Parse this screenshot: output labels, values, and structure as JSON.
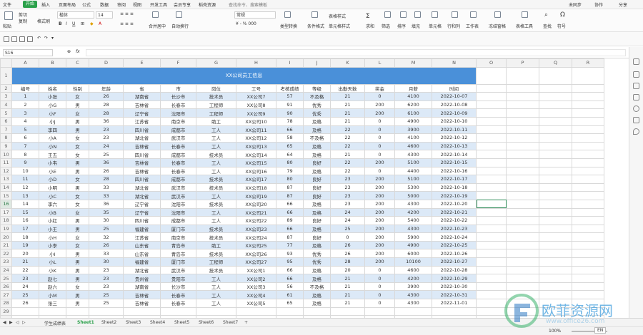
{
  "menubar": {
    "items": [
      "文件",
      "开始",
      "插入",
      "页面布局",
      "公式",
      "数据",
      "审阅",
      "视图",
      "开发工具",
      "会员专享",
      "稻壳资源"
    ],
    "search": "查找命令、搜索模板",
    "right": [
      "未同步",
      "协作",
      "分享"
    ]
  },
  "ribbon": {
    "left": [
      "粘贴",
      "剪切",
      "复制",
      "格式刷"
    ],
    "font_name": "楷体",
    "font_size": "14",
    "merge": "合并居中",
    "wrap": "自动换行",
    "number_format": "常规",
    "labels": [
      "类型转换",
      "条件格式",
      "表格样式",
      "单元格样式",
      "求和",
      "筛选",
      "排序",
      "填充",
      "单元格",
      "行和列",
      "工作表",
      "冻结窗格",
      "表格工具",
      "查找",
      "符号"
    ]
  },
  "formula_bar": {
    "cell_ref": "S16",
    "fx": "fx",
    "content": ""
  },
  "columns": [
    "A",
    "B",
    "C",
    "D",
    "E",
    "F",
    "G",
    "H",
    "I",
    "J",
    "K",
    "L",
    "M",
    "N",
    "O",
    "P",
    "Q",
    "R",
    "S",
    "T",
    "U",
    "V"
  ],
  "selected_col": "S",
  "selected_row": "16",
  "title": "XX公司员工信息",
  "headers": [
    "编号",
    "姓名",
    "性别",
    "年龄",
    "省",
    "市",
    "岗位",
    "工号",
    "考核成绩",
    "等级",
    "出勤天数",
    "奖金",
    "月薪",
    "时间"
  ],
  "rows": [
    [
      "1",
      "小张",
      "女",
      "26",
      "湖南省",
      "长沙市",
      "技术员",
      "XX公司7",
      "57",
      "不及格",
      "21",
      "0",
      "4100",
      "2022-10-07"
    ],
    [
      "2",
      "小G",
      "男",
      "28",
      "吉林省",
      "长春市",
      "工程师",
      "XX公司8",
      "91",
      "优秀",
      "21",
      "200",
      "6200",
      "2022-10-08"
    ],
    [
      "3",
      "小F",
      "女",
      "28",
      "辽宁省",
      "沈阳市",
      "工程师",
      "XX公司9",
      "90",
      "优秀",
      "21",
      "200",
      "6100",
      "2022-10-09"
    ],
    [
      "4",
      "小J",
      "男",
      "36",
      "江苏省",
      "南京市",
      "助工",
      "XX公司10",
      "78",
      "及格",
      "21",
      "0",
      "4900",
      "2022-10-10"
    ],
    [
      "5",
      "李四",
      "男",
      "23",
      "四川省",
      "成都市",
      "工人",
      "XX公司11",
      "66",
      "及格",
      "22",
      "0",
      "3900",
      "2022-10-11"
    ],
    [
      "6",
      "小A",
      "女",
      "23",
      "湖北省",
      "武汉市",
      "工人",
      "XX公司12",
      "58",
      "不及格",
      "22",
      "0",
      "4100",
      "2022-10-12"
    ],
    [
      "7",
      "小N",
      "女",
      "24",
      "吉林省",
      "长春市",
      "工人",
      "XX公司13",
      "65",
      "及格",
      "22",
      "0",
      "4600",
      "2022-10-13"
    ],
    [
      "8",
      "王五",
      "女",
      "25",
      "四川省",
      "成都市",
      "技术员",
      "XX公司14",
      "64",
      "及格",
      "21",
      "0",
      "4300",
      "2022-10-14"
    ],
    [
      "9",
      "小韦",
      "男",
      "36",
      "吉林省",
      "长春市",
      "工人",
      "XX公司15",
      "80",
      "良好",
      "22",
      "200",
      "5100",
      "2022-10-15"
    ],
    [
      "10",
      "小E",
      "男",
      "26",
      "吉林省",
      "长春市",
      "工人",
      "XX公司16",
      "79",
      "及格",
      "22",
      "0",
      "4400",
      "2022-10-16"
    ],
    [
      "11",
      "小D",
      "女",
      "28",
      "四川省",
      "成都市",
      "技术员",
      "XX公司17",
      "80",
      "良好",
      "23",
      "200",
      "5100",
      "2022-10-17"
    ],
    [
      "12",
      "小明",
      "男",
      "33",
      "湖北省",
      "武汉市",
      "技术员",
      "XX公司18",
      "87",
      "良好",
      "23",
      "200",
      "5300",
      "2022-10-18"
    ],
    [
      "13",
      "小C",
      "女",
      "33",
      "湖北省",
      "武汉市",
      "工人",
      "XX公司19",
      "87",
      "良好",
      "23",
      "200",
      "5000",
      "2022-10-19"
    ],
    [
      "14",
      "李六",
      "女",
      "36",
      "辽宁省",
      "沈阳市",
      "技术员",
      "XX公司20",
      "66",
      "及格",
      "23",
      "200",
      "4300",
      "2022-10-20"
    ],
    [
      "15",
      "小B",
      "女",
      "35",
      "辽宁省",
      "沈阳市",
      "工人",
      "XX公司21",
      "66",
      "及格",
      "24",
      "200",
      "4200",
      "2022-10-21"
    ],
    [
      "16",
      "小红",
      "男",
      "30",
      "四川省",
      "成都市",
      "工人",
      "XX公司22",
      "89",
      "良好",
      "24",
      "200",
      "5400",
      "2022-10-22"
    ],
    [
      "17",
      "小王",
      "男",
      "25",
      "福建省",
      "厦门市",
      "技术员",
      "XX公司23",
      "66",
      "及格",
      "25",
      "200",
      "4300",
      "2022-10-23"
    ],
    [
      "18",
      "小H",
      "女",
      "32",
      "江苏省",
      "南京市",
      "技术员",
      "XX公司24",
      "87",
      "良好",
      "0",
      "200",
      "5900",
      "2022-10-24"
    ],
    [
      "19",
      "小李",
      "女",
      "26",
      "山东省",
      "青岛市",
      "助工",
      "XX公司25",
      "77",
      "及格",
      "26",
      "200",
      "4900",
      "2022-10-25"
    ],
    [
      "20",
      "小I",
      "男",
      "33",
      "山东省",
      "青岛市",
      "技术员",
      "XX公司26",
      "93",
      "优秀",
      "26",
      "200",
      "6000",
      "2022-10-26"
    ],
    [
      "21",
      "小L",
      "男",
      "30",
      "福建省",
      "厦门市",
      "工程师",
      "XX公司27",
      "95",
      "优秀",
      "28",
      "200",
      "10100",
      "2022-10-27"
    ],
    [
      "22",
      "小K",
      "男",
      "23",
      "湖北省",
      "武汉市",
      "技术员",
      "XX公司1",
      "66",
      "及格",
      "20",
      "0",
      "4600",
      "2022-10-28"
    ],
    [
      "23",
      "赵七",
      "男",
      "23",
      "贵州省",
      "贵阳市",
      "工人",
      "XX公司2",
      "66",
      "及格",
      "21",
      "0",
      "4200",
      "2022-10-29"
    ],
    [
      "24",
      "赵六",
      "女",
      "23",
      "湖南省",
      "长沙市",
      "工人",
      "XX公司3",
      "56",
      "不及格",
      "21",
      "0",
      "3900",
      "2022-10-30"
    ],
    [
      "25",
      "小M",
      "男",
      "25",
      "吉林省",
      "长春市",
      "工人",
      "XX公司4",
      "61",
      "及格",
      "21",
      "0",
      "4300",
      "2022-10-31"
    ],
    [
      "26",
      "张三",
      "男",
      "25",
      "吉林省",
      "长春市",
      "工人",
      "XX公司5",
      "65",
      "及格",
      "21",
      "0",
      "4300",
      "2022-11-01"
    ]
  ],
  "empty_row_numbers": [
    "29",
    "30"
  ],
  "sheet_tabs": [
    "学生成绩表",
    "Sheet1",
    "Sheet2",
    "Sheet3",
    "Sheet4",
    "Sheet5",
    "Sheet6",
    "Sheet7"
  ],
  "active_tab": "Sheet1",
  "status": {
    "zoom": "100%",
    "lang": "EN"
  },
  "watermark": {
    "text": "欧菲资源网",
    "url": "www.office26.com"
  },
  "colors": {
    "accent": "#2aa04a",
    "title_bg": "#4a90d9",
    "band": "#dce9f7"
  }
}
